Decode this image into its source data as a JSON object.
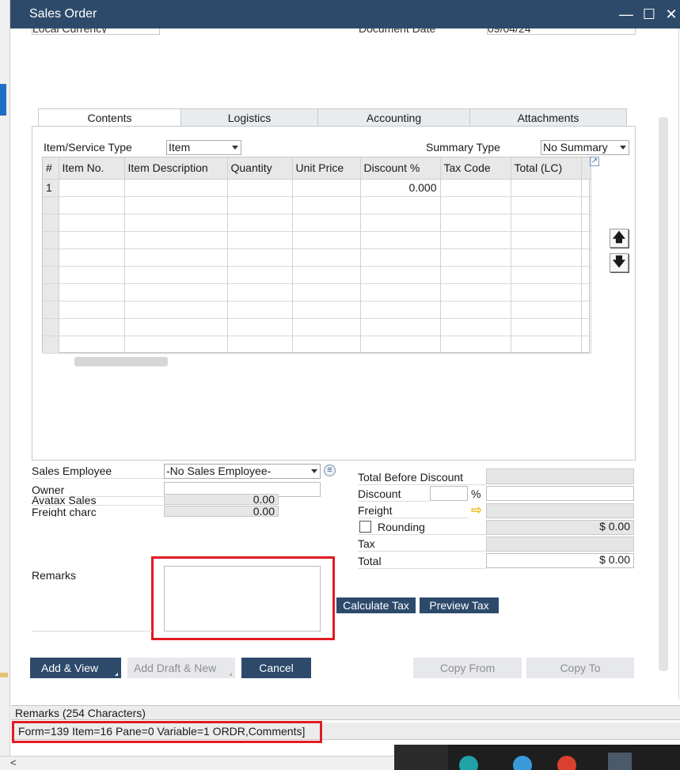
{
  "window": {
    "title": "Sales Order",
    "minimize": "—",
    "maximize": "☐",
    "close": "✕"
  },
  "header_cut": {
    "local_currency": "Local Currency",
    "document_date": "Document Date",
    "document_date_value": "09/04/24"
  },
  "tabs": [
    {
      "label": "Contents",
      "active": true
    },
    {
      "label": "Logistics",
      "active": false
    },
    {
      "label": "Accounting",
      "active": false
    },
    {
      "label": "Attachments",
      "active": false
    }
  ],
  "contents": {
    "item_service_type_label": "Item/Service Type",
    "item_service_type_value": "Item",
    "summary_type_label": "Summary Type",
    "summary_type_value": "No Summary"
  },
  "grid": {
    "columns": [
      "#",
      "Item No.",
      "Item Description",
      "Quantity",
      "Unit Price",
      "Discount %",
      "Tax Code",
      "Total (LC)",
      ""
    ],
    "rows": [
      [
        "1",
        "",
        "",
        "",
        "",
        "0.000",
        "",
        "",
        ""
      ],
      [
        "",
        "",
        "",
        "",
        "",
        "",
        "",
        "",
        ""
      ],
      [
        "",
        "",
        "",
        "",
        "",
        "",
        "",
        "",
        ""
      ],
      [
        "",
        "",
        "",
        "",
        "",
        "",
        "",
        "",
        ""
      ],
      [
        "",
        "",
        "",
        "",
        "",
        "",
        "",
        "",
        ""
      ],
      [
        "",
        "",
        "",
        "",
        "",
        "",
        "",
        "",
        ""
      ],
      [
        "",
        "",
        "",
        "",
        "",
        "",
        "",
        "",
        ""
      ],
      [
        "",
        "",
        "",
        "",
        "",
        "",
        "",
        "",
        ""
      ],
      [
        "",
        "",
        "",
        "",
        "",
        "",
        "",
        "",
        ""
      ],
      [
        "",
        "",
        "",
        "",
        "",
        "",
        "",
        "",
        ""
      ]
    ]
  },
  "icons": {
    "move_up": "🡅",
    "move_down": "🡇",
    "expand": "↗",
    "freight_arrow": "⇨",
    "list": "≡",
    "scroll_left": "<"
  },
  "left_fields": {
    "sales_employee_label": "Sales Employee",
    "sales_employee_value": "-No Sales Employee-",
    "owner_label": "Owner",
    "owner_value": "",
    "avatax_sales_label": "Avatax Sales",
    "avatax_sales_value": "0.00",
    "freight_charge_label": "Freight charc",
    "freight_charge_value": "0.00",
    "remarks_label": "Remarks",
    "remarks_value": ""
  },
  "totals": {
    "total_before_discount_label": "Total Before Discount",
    "total_before_discount_value": "",
    "discount_label": "Discount",
    "discount_percent": "",
    "percent_sign": "%",
    "discount_value": "",
    "freight_label": "Freight",
    "freight_value": "",
    "rounding_label": "Rounding",
    "rounding_value": "$ 0.00",
    "tax_label": "Tax",
    "tax_value": "",
    "total_label": "Total",
    "total_value": "$ 0.00"
  },
  "tax_buttons": {
    "calculate_tax": "Calculate Tax",
    "preview_tax": "Preview Tax"
  },
  "footer_buttons": {
    "add_view": "Add & View",
    "add_draft_new": "Add Draft & New",
    "cancel": "Cancel",
    "copy_from": "Copy From",
    "copy_to": "Copy To"
  },
  "status": {
    "line1": "Remarks (254 Characters)",
    "line2": "Form=139 Item=16 Pane=0 Variable=1 ORDR,Comments]"
  }
}
